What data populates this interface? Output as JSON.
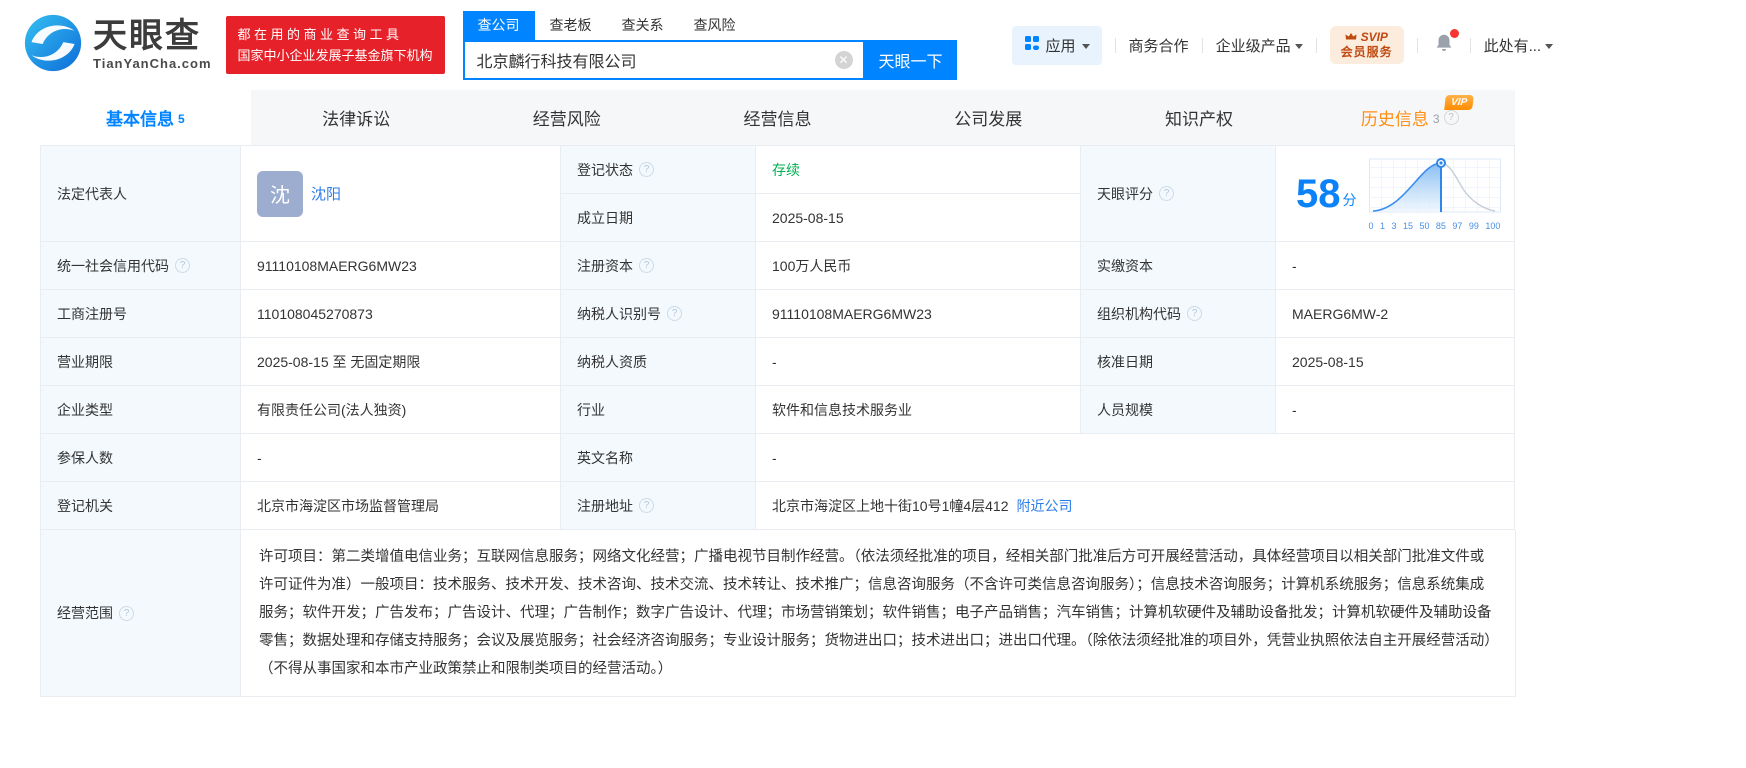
{
  "header": {
    "brand": "天眼查",
    "brand_domain": "TianYanCha.com",
    "promo_line1": "都在用的商业查询工具",
    "promo_line2": "国家中小企业发展子基金旗下机构",
    "search": {
      "tabs": [
        {
          "label": "查公司"
        },
        {
          "label": "查老板"
        },
        {
          "label": "查关系"
        },
        {
          "label": "查风险"
        }
      ],
      "value": "北京麟行科技有限公司",
      "button": "天眼一下"
    },
    "nav": {
      "apps": "应用",
      "cooperation": "商务合作",
      "enterprise": "企业级产品",
      "svip_line1": "SVIP",
      "svip_line2": "会员服务",
      "user": "此处有..."
    }
  },
  "tabs": [
    {
      "label": "基本信息",
      "count": "5"
    },
    {
      "label": "法律诉讼"
    },
    {
      "label": "经营风险"
    },
    {
      "label": "经营信息"
    },
    {
      "label": "公司发展"
    },
    {
      "label": "知识产权"
    },
    {
      "label": "历史信息",
      "count": "3",
      "badge": "VIP"
    }
  ],
  "score": {
    "label": "天眼评分",
    "value": "58",
    "unit": "分",
    "axis": [
      "0",
      "1",
      "3",
      "15",
      "50",
      "85",
      "97",
      "99",
      "100"
    ]
  },
  "fields": {
    "legal_rep": {
      "label": "法定代表人",
      "avatar": "沈",
      "name": "沈阳"
    },
    "reg_status": {
      "label": "登记状态",
      "value": "存续"
    },
    "est_date": {
      "label": "成立日期",
      "value": "2025-08-15"
    },
    "uscc": {
      "label": "统一社会信用代码",
      "value": "91110108MAERG6MW23"
    },
    "reg_capital": {
      "label": "注册资本",
      "value": "100万人民币"
    },
    "paid_capital": {
      "label": "实缴资本",
      "value": "-"
    },
    "reg_no": {
      "label": "工商注册号",
      "value": "110108045270873"
    },
    "taxpayer_id": {
      "label": "纳税人识别号",
      "value": "91110108MAERG6MW23"
    },
    "org_code": {
      "label": "组织机构代码",
      "value": "MAERG6MW-2"
    },
    "biz_term": {
      "label": "营业期限",
      "value": "2025-08-15 至 无固定期限"
    },
    "taxpayer_quality": {
      "label": "纳税人资质",
      "value": "-"
    },
    "approval_date": {
      "label": "核准日期",
      "value": "2025-08-15"
    },
    "company_type": {
      "label": "企业类型",
      "value": "有限责任公司(法人独资)"
    },
    "industry": {
      "label": "行业",
      "value": "软件和信息技术服务业"
    },
    "staff_size": {
      "label": "人员规模",
      "value": "-"
    },
    "insured_count": {
      "label": "参保人数",
      "value": "-"
    },
    "english_name": {
      "label": "英文名称",
      "value": "-"
    },
    "reg_authority": {
      "label": "登记机关",
      "value": "北京市海淀区市场监督管理局"
    },
    "reg_address": {
      "label": "注册地址",
      "value": "北京市海淀区上地十街10号1幢4层412",
      "link": "附近公司"
    },
    "business_scope": {
      "label": "经营范围",
      "value": "许可项目：第二类增值电信业务；互联网信息服务；网络文化经营；广播电视节目制作经营。（依法须经批准的项目，经相关部门批准后方可开展经营活动，具体经营项目以相关部门批准文件或许可证件为准）一般项目：技术服务、技术开发、技术咨询、技术交流、技术转让、技术推广；信息咨询服务（不含许可类信息咨询服务）；信息技术咨询服务；计算机系统服务；信息系统集成服务；软件开发；广告发布；广告设计、代理；广告制作；数字广告设计、代理；市场营销策划；软件销售；电子产品销售；汽车销售；计算机软硬件及辅助设备批发；计算机软硬件及辅助设备零售；数据处理和存储支持服务；会议及展览服务；社会经济咨询服务；专业设计服务；货物进出口；技术进出口；进出口代理。（除依法须经批准的项目外，凭营业执照依法自主开展经营活动）（不得从事国家和本市产业政策禁止和限制类项目的经营活动。）"
    }
  },
  "colors": {
    "accent": "#0084ff",
    "status_green": "#00b152",
    "history_orange": "#ff8e14",
    "promo_red": "#e62129",
    "link_blue": "#2b7ce9"
  }
}
